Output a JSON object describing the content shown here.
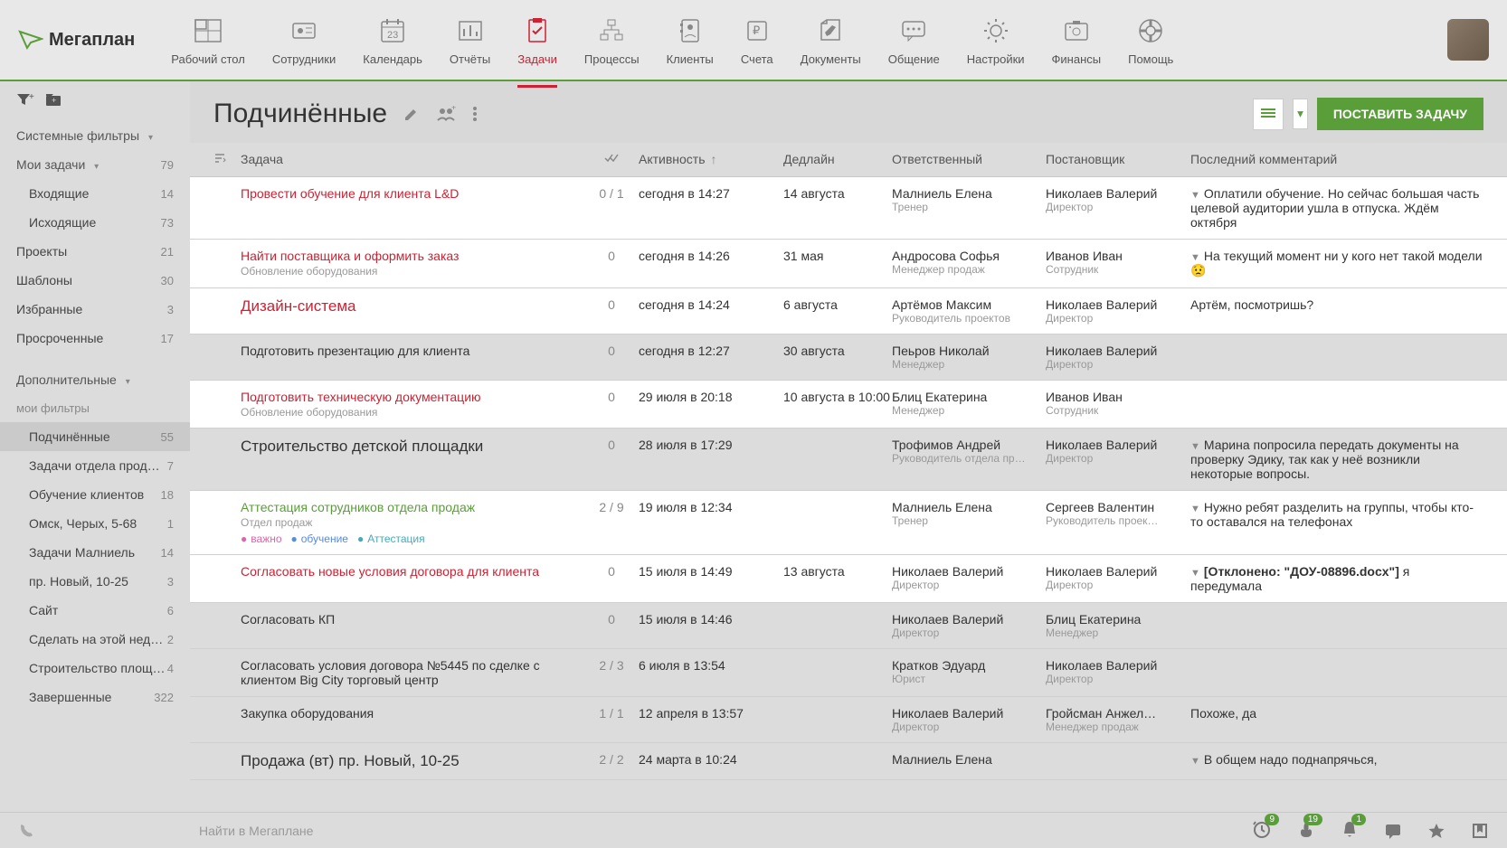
{
  "logo": "Мегаплан",
  "nav": [
    {
      "label": "Рабочий стол"
    },
    {
      "label": "Сотрудники"
    },
    {
      "label": "Календарь",
      "num": "23"
    },
    {
      "label": "Отчёты"
    },
    {
      "label": "Задачи",
      "active": true
    },
    {
      "label": "Процессы"
    },
    {
      "label": "Клиенты"
    },
    {
      "label": "Счета"
    },
    {
      "label": "Документы"
    },
    {
      "label": "Общение"
    },
    {
      "label": "Настройки"
    },
    {
      "label": "Финансы"
    },
    {
      "label": "Помощь"
    }
  ],
  "sidebar": {
    "sections": [
      {
        "label": "Системные фильтры",
        "type": "header",
        "chev": true
      },
      {
        "label": "Мои задачи",
        "type": "header",
        "chev": true,
        "count": "79"
      },
      {
        "label": "Входящие",
        "type": "indent",
        "count": "14"
      },
      {
        "label": "Исходящие",
        "type": "indent",
        "count": "73"
      },
      {
        "label": "Проекты",
        "count": "21"
      },
      {
        "label": "Шаблоны",
        "count": "30"
      },
      {
        "label": "Избранные",
        "count": "3"
      },
      {
        "label": "Просроченные",
        "count": "17"
      },
      {
        "label": "Дополнительные",
        "type": "header",
        "chev": true,
        "gap": true
      },
      {
        "label": "мои фильтры",
        "type": "label"
      },
      {
        "label": "Подчинённые",
        "count": "55",
        "active": true,
        "indent": true
      },
      {
        "label": "Задачи отдела прод…",
        "count": "7",
        "indent": true
      },
      {
        "label": "Обучение клиентов",
        "count": "18",
        "indent": true
      },
      {
        "label": "Омск, Черых, 5-68",
        "count": "1",
        "indent": true
      },
      {
        "label": "Задачи Малниель",
        "count": "14",
        "indent": true
      },
      {
        "label": "пр. Новый, 10-25",
        "count": "3",
        "indent": true
      },
      {
        "label": "Сайт",
        "count": "6",
        "indent": true
      },
      {
        "label": "Сделать на этой нед…",
        "count": "2",
        "indent": true
      },
      {
        "label": "Строительство площ…",
        "count": "4",
        "indent": true
      },
      {
        "label": "Завершенные",
        "count": "322",
        "indent": true
      }
    ]
  },
  "page": {
    "title": "Подчинённые",
    "create_btn": "ПОСТАВИТЬ ЗАДАЧУ"
  },
  "columns": {
    "task": "Задача",
    "activity": "Активность",
    "deadline": "Дедлайн",
    "resp": "Ответственный",
    "setter": "Постановщик",
    "comment": "Последний комментарий"
  },
  "rows": [
    {
      "bg": "white",
      "title": "Провести обучение для клиента L&D",
      "titleClass": "red",
      "check": "0 / 1",
      "activity": "сегодня в 14:27",
      "deadline": "14 августа",
      "resp": "Малниель Елена",
      "resp_sub": "Тренер",
      "setter": "Николаев Валерий",
      "setter_sub": "Директор",
      "comment": "Оплатили обучение. Но сейчас большая часть целевой аудитории ушла в отпуска. Ждём октября",
      "arrow": true
    },
    {
      "bg": "white",
      "title": "Найти поставщика и оформить заказ",
      "titleClass": "red",
      "sub": "Обновление оборудования",
      "check": "0",
      "activity": "сегодня в 14:26",
      "deadline": "31 мая",
      "resp": "Андросова Софья",
      "resp_sub": "Менеджер продаж",
      "setter": "Иванов Иван",
      "setter_sub": "Сотрудник",
      "comment": "На текущий момент ни у кого нет такой модели 😟",
      "arrow": true
    },
    {
      "bg": "white",
      "title": "Дизайн-система",
      "titleClass": "red big",
      "check": "0",
      "activity": "сегодня в 14:24",
      "deadline": "6 августа",
      "resp": "Артёмов Максим",
      "resp_sub": "Руководитель проектов",
      "setter": "Николаев Валерий",
      "setter_sub": "Директор",
      "comment": "Артём, посмотришь?"
    },
    {
      "bg": "grey",
      "title": "Подготовить презентацию для клиента",
      "check": "0",
      "activity": "сегодня в 12:27",
      "deadline": "30 августа",
      "resp": "Пеьров Николай",
      "resp_sub": "Менеджер",
      "setter": "Николаев Валерий",
      "setter_sub": "Директор"
    },
    {
      "bg": "white",
      "title": "Подготовить техническую документацию",
      "titleClass": "red",
      "sub": "Обновление оборудования",
      "check": "0",
      "activity": "29 июля в 20:18",
      "deadline": "10 августа в 10:00",
      "resp": "Блиц Екатерина",
      "resp_sub": "Менеджер",
      "setter": "Иванов Иван",
      "setter_sub": "Сотрудник"
    },
    {
      "bg": "grey",
      "title": "Строительство детской площадки",
      "titleClass": "big",
      "check": "0",
      "activity": "28 июля в 17:29",
      "deadline": "",
      "resp": "Трофимов Андрей",
      "resp_sub": "Руководитель отдела пр…",
      "setter": "Николаев Валерий",
      "setter_sub": "Директор",
      "comment": "Марина попросила передать документы на проверку Эдику, так как у неё возникли некоторые вопросы.",
      "arrow": true
    },
    {
      "bg": "white",
      "title": "Аттестация сотрудников отдела продаж",
      "titleClass": "green",
      "sub": "Отдел продаж",
      "tags": [
        {
          "c": "pink",
          "t": "важно"
        },
        {
          "c": "blue",
          "t": "обучение"
        },
        {
          "c": "teal",
          "t": "Аттестация"
        }
      ],
      "check": "2 / 9",
      "activity": "19 июля в 12:34",
      "deadline": "",
      "resp": "Малниель Елена",
      "resp_sub": "Тренер",
      "setter": "Сергеев Валентин",
      "setter_sub": "Руководитель проек…",
      "comment": "Нужно ребят разделить на группы, чтобы кто-то оставался на телефонах",
      "arrow": true
    },
    {
      "bg": "white",
      "title": "Согласовать новые условия договора для клиента",
      "titleClass": "red",
      "check": "0",
      "activity": "15 июля в 14:49",
      "deadline": "13 августа",
      "resp": "Николаев Валерий",
      "resp_sub": "Директор",
      "setter": "Николаев Валерий",
      "setter_sub": "Директор",
      "comment": "[Отклонено: \"ДОУ-08896.docx\"] я передумала",
      "arrow": true,
      "bold": true
    },
    {
      "bg": "grey",
      "title": "Согласовать КП",
      "check": "0",
      "activity": "15 июля в 14:46",
      "deadline": "",
      "resp": "Николаев Валерий",
      "resp_sub": "Директор",
      "setter": "Блиц Екатерина",
      "setter_sub": "Менеджер"
    },
    {
      "bg": "grey",
      "title": "Согласовать условия договора №5445 по сделке с клиентом Big City торговый центр",
      "check": "2 / 3",
      "activity": "6 июля в 13:54",
      "deadline": "",
      "resp": "Кратков Эдуард",
      "resp_sub": "Юрист",
      "setter": "Николаев Валерий",
      "setter_sub": "Директор"
    },
    {
      "bg": "grey",
      "title": "Закупка оборудования",
      "check": "1 / 1",
      "activity": "12 апреля в 13:57",
      "deadline": "",
      "resp": "Николаев Валерий",
      "resp_sub": "Директор",
      "setter": "Гройсман Анжел…",
      "setter_sub": "Менеджер продаж",
      "comment": "Похоже, да"
    },
    {
      "bg": "grey",
      "title": "Продажа (вт) пр. Новый, 10-25",
      "titleClass": "big",
      "check": "2 / 2",
      "activity": "24 марта в 10:24",
      "deadline": "",
      "resp": "Малниель Елена",
      "resp_sub": "",
      "setter": "",
      "setter_sub": "",
      "comment": "В общем надо поднапрячься,",
      "arrow": true
    }
  ],
  "bottom": {
    "search_placeholder": "Найти в Мегаплане",
    "badges": {
      "clock": "9",
      "fire": "19",
      "bell": "1"
    }
  }
}
